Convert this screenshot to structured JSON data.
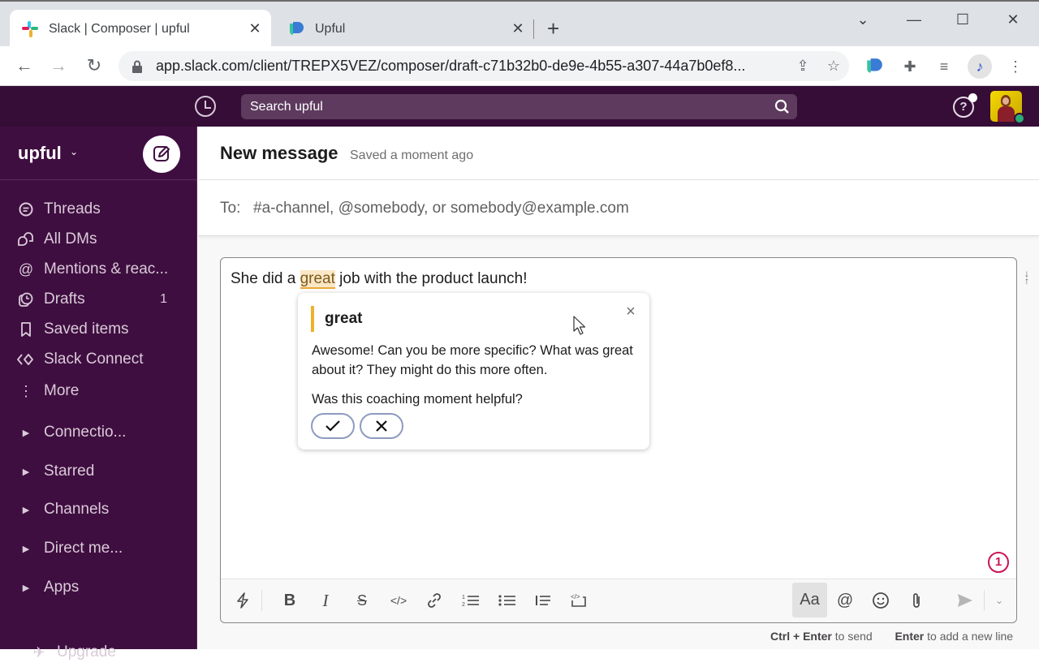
{
  "browser": {
    "tabs": [
      {
        "title": "Slack | Composer | upful",
        "active": true,
        "favicon": "slack-logo-icon"
      },
      {
        "title": "Upful",
        "active": false,
        "favicon": "upful-logo-icon"
      }
    ],
    "new_tab_label": "+",
    "url": "app.slack.com/client/TREPX5VEZ/composer/draft-c71b32b0-de9e-4b55-a307-44a7b0ef8...",
    "window_controls": {
      "tab_list": "⌄",
      "minimize": "—",
      "maximize": "☐",
      "close": "✕"
    },
    "icons": {
      "back": "←",
      "forward": "→",
      "reload": "↻",
      "share": "⇪",
      "star": "☆",
      "puzzle": "✚",
      "media": "≡",
      "menu": "⋮"
    }
  },
  "topbar": {
    "search_placeholder": "Search upful",
    "help_label": "?"
  },
  "sidebar": {
    "workspace": "upful",
    "workspace_chevron": "⌄",
    "nav_items": [
      {
        "label": "Threads",
        "icon": "threads-icon",
        "glyph": "☰"
      },
      {
        "label": "All DMs",
        "icon": "all-dms-icon",
        "glyph": "⌂"
      },
      {
        "label": "Mentions & reac...",
        "icon": "mentions-icon",
        "glyph": "@"
      },
      {
        "label": "Drafts",
        "icon": "drafts-icon",
        "glyph": "◷",
        "count": "1"
      },
      {
        "label": "Saved items",
        "icon": "bookmark-icon",
        "glyph": "⚑"
      },
      {
        "label": "Slack Connect",
        "icon": "slack-connect-icon",
        "glyph": "«»"
      },
      {
        "label": "More",
        "icon": "more-vertical-icon",
        "glyph": "⋮"
      }
    ],
    "sections": [
      {
        "label": "Connectio..."
      },
      {
        "label": "Starred"
      },
      {
        "label": "Channels"
      },
      {
        "label": "Direct me..."
      },
      {
        "label": "Apps"
      }
    ],
    "section_caret": "▶",
    "partial_bottom_item": "Upgrade"
  },
  "main": {
    "title": "New message",
    "saved_status": "Saved a moment ago",
    "to_label": "To:",
    "to_placeholder": "#a-channel, @somebody, or somebody@example.com",
    "message": {
      "before": "She did a ",
      "highlight": "great",
      "after": " job with the product launch!"
    },
    "coaching_count": "1",
    "toolbar": {
      "shortcuts": "ϟ",
      "bold": "B",
      "italic": "I",
      "strike": "S",
      "code": "</>",
      "link": "⛓",
      "ordered_list": "≔",
      "bullet_list": "☰",
      "blockquote": "▎≡",
      "code_block": "⟨/⟩",
      "formatting": "Aa",
      "mention": "@",
      "emoji": "☺",
      "attach": "⎘",
      "send": "➤",
      "send_options": "⌄"
    },
    "hints": {
      "send_key": "Ctrl + Enter",
      "send_text": " to send",
      "newline_key": "Enter",
      "newline_text": " to add a new line"
    }
  },
  "coaching_popup": {
    "word": "great",
    "message": "Awesome! Can you be more specific? What was great about it? They might do this more often.",
    "question": "Was this coaching moment helpful?",
    "close": "×",
    "accent_color": "#ecb22e"
  },
  "colors": {
    "slack_aubergine": "#3f0e40",
    "topbar": "#350d36",
    "highlight_bg": "#fbe7c6",
    "badge": "#cc1455",
    "presence": "#2bac76"
  }
}
